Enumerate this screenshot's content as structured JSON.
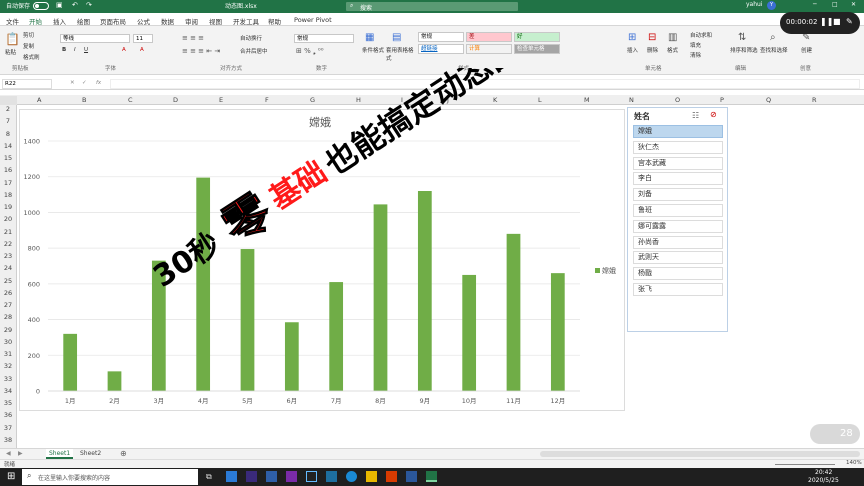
{
  "window": {
    "autosave": "自动保存",
    "filename": "动态图.xlsx",
    "search": "搜索",
    "user": "yahui",
    "close": "✕",
    "maximize": "□",
    "minimize": "─"
  },
  "tabs": [
    "文件",
    "开始",
    "插入",
    "绘图",
    "页面布局",
    "公式",
    "数据",
    "审阅",
    "视图",
    "开发工具",
    "帮助",
    "Power Pivot"
  ],
  "ribbon": {
    "clipboard": {
      "cut": "剪切",
      "copy": "复制",
      "paste": "粘贴",
      "format_painter": "格式刷",
      "group": "剪贴板"
    },
    "font": {
      "name": "等线",
      "size": "11",
      "group": "字体"
    },
    "align": {
      "wrap": "自动换行",
      "merge": "合并后居中",
      "group": "对齐方式"
    },
    "number": {
      "format": "常规",
      "group": "数字"
    },
    "styles": {
      "cond": "条件格式",
      "table": "套用表格格式",
      "normal": "常规",
      "bad": "差",
      "good": "好",
      "hyperlink": "超链接",
      "calc": "计算",
      "check": "检查单元格",
      "group": "样式"
    },
    "cells": {
      "insert": "插入",
      "delete": "删除",
      "format": "格式",
      "group": "单元格"
    },
    "editing": {
      "autosum": "自动求和",
      "fill": "填充",
      "clear": "清除",
      "sort": "排序和筛选",
      "find": "查找和选择",
      "group": "编辑"
    },
    "create": {
      "label": "创建",
      "group": "创意"
    }
  },
  "formula_bar": {
    "cellref": "R22",
    "fx": "fx",
    "value": ""
  },
  "columns": [
    "A",
    "B",
    "C",
    "D",
    "E",
    "F",
    "G",
    "H",
    "I",
    "J",
    "K",
    "L",
    "M",
    "N",
    "O",
    "P",
    "Q",
    "R"
  ],
  "rows": [
    "2",
    "7",
    "8",
    "14",
    "15",
    "16",
    "17",
    "18",
    "19",
    "20",
    "21",
    "22",
    "23",
    "24",
    "25",
    "26",
    "27",
    "28",
    "29",
    "30",
    "31",
    "32",
    "33",
    "34",
    "35",
    "36",
    "37",
    "38"
  ],
  "chart_data": {
    "type": "bar",
    "title": "嫦娥",
    "categories": [
      "1月",
      "2月",
      "3月",
      "4月",
      "5月",
      "6月",
      "7月",
      "8月",
      "9月",
      "10月",
      "11月",
      "12月"
    ],
    "series": [
      {
        "name": "嫦娥",
        "values": [
          320,
          110,
          730,
          1195,
          795,
          385,
          610,
          1045,
          1120,
          650,
          880,
          660
        ],
        "color": "#70ad47"
      }
    ],
    "ylim": [
      0,
      1400
    ],
    "yticks": [
      "0",
      "200",
      "400",
      "600",
      "800",
      "1000",
      "1200",
      "1400"
    ],
    "grid": true,
    "legend": "right"
  },
  "slicer": {
    "title": "姓名",
    "items": [
      "嫦娥",
      "狄仁杰",
      "宫本武藏",
      "李白",
      "刘备",
      "鲁班",
      "娜可露露",
      "孙尚香",
      "武则天",
      "杨戬",
      "张飞"
    ],
    "selected": 0
  },
  "overlay": {
    "prefix": "30秒",
    "zero": "零",
    "base": "基础",
    "rest": "也能搞定动态图"
  },
  "sheets": [
    "Sheet1",
    "Sheet2"
  ],
  "statusbar": {
    "ready": "就绪",
    "zoom": "140%"
  },
  "taskbar": {
    "search": "在这里输入你要搜索的内容",
    "time": "20:42",
    "date": "2020/5/25"
  },
  "recorder": {
    "time": "00:00:02"
  },
  "badge": "28"
}
